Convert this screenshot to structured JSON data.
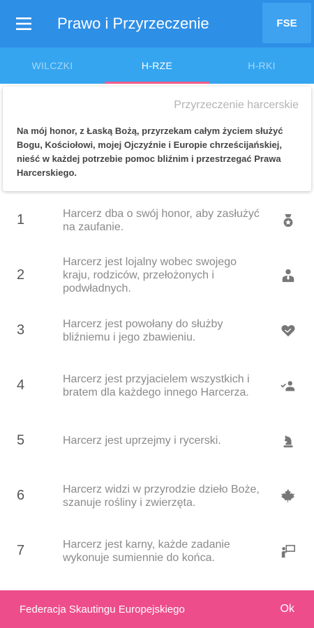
{
  "appbar": {
    "title": "Prawo i Przyrzeczenie",
    "action_label": "FSE",
    "menu_icon": "menu-icon"
  },
  "tabs": [
    {
      "label": "WILCZKI",
      "active": false
    },
    {
      "label": "H-RZE",
      "active": true
    },
    {
      "label": "H-RKI",
      "active": false
    }
  ],
  "promise": {
    "title": "Przyrzeczenie harcerskie",
    "text": "Na mój honor, z Łaską Bożą, przyrzekam całym życiem służyć Bogu, Kościołowi, mojej Ojczyźnie i Europie chrześcijańskiej, nieść w każdej potrzebie pomoc bliźnim i przestrzegać Prawa Harcerskiego."
  },
  "laws": [
    {
      "number": "1",
      "text": "Harcerz dba o swój honor, aby zasłużyć na zaufanie.",
      "icon": "medal-icon"
    },
    {
      "number": "2",
      "text": "Harcerz jest lojalny wobec swojego kraju, rodziców, przełożonych i podwładnych.",
      "icon": "person-tie-icon"
    },
    {
      "number": "3",
      "text": "Harcerz jest powołany do służby bliźniemu i jego zbawieniu.",
      "icon": "heart-hands-icon"
    },
    {
      "number": "4",
      "text": "Harcerz jest przyjacielem wszystkich i bratem dla każdego innego Harcerza.",
      "icon": "group-check-icon"
    },
    {
      "number": "5",
      "text": "Harcerz jest uprzejmy i rycerski.",
      "icon": "chess-knight-icon"
    },
    {
      "number": "6",
      "text": "Harcerz widzi w przyrodzie dzieło Boże, szanuje rośliny i zwierzęta.",
      "icon": "maple-leaf-icon"
    },
    {
      "number": "7",
      "text": "Harcerz jest karny, każde zadanie wykonuje sumiennie do końca.",
      "icon": "presenter-icon"
    }
  ],
  "footer": {
    "text": "Federacja Skautingu Europejskiego",
    "ok_label": "Ok"
  },
  "colors": {
    "appbar": "#2e8fe6",
    "tabs": "#35a5ef",
    "tab_indicator": "#f05a8a",
    "footer": "#ee4d8b"
  }
}
